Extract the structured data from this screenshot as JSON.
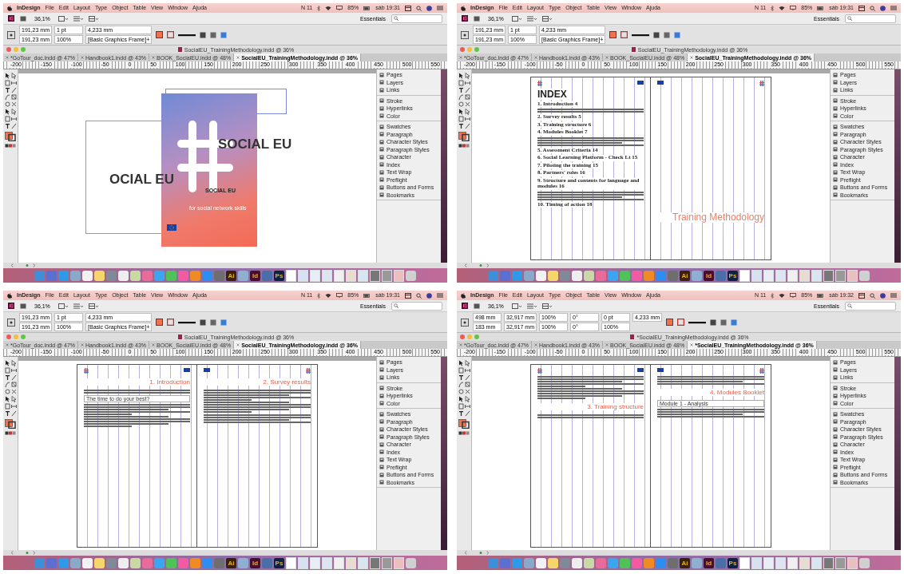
{
  "screens": [
    {
      "menubar": {
        "app": "InDesign",
        "menus": [
          "File",
          "Edit",
          "Layout",
          "Type",
          "Object",
          "Table",
          "View",
          "Window",
          "Ajuda"
        ],
        "status": [
          "N 11",
          "85%",
          "sáb 19:31"
        ]
      },
      "appbar": {
        "zoom": "36,1%",
        "workspace": "Essentials"
      },
      "control_fields": [
        "191,23 mm",
        "191,23 mm",
        "1 pt",
        "100%",
        "4,233 mm",
        "[Basic Graphics Frame]+"
      ],
      "document_title": "SocialEU_TrainingMethodology.indd @ 36%",
      "tabs": [
        {
          "label": "*GoTour_doc.indd @ 47%",
          "selected": false
        },
        {
          "label": "Handbook1.indd @ 43%",
          "selected": false
        },
        {
          "label": "BOOK_SocialEU.indd @ 48%",
          "selected": false
        },
        {
          "label": "SocialEU_TrainingMethodology.indd @ 36%",
          "selected": true
        }
      ],
      "ruler": [
        "-200",
        "-150",
        "-100",
        "-50",
        "0",
        "50",
        "100",
        "150",
        "200",
        "250",
        "300",
        "350",
        "400",
        "450",
        "500",
        "550"
      ],
      "panels": [
        [
          "Pages",
          "Layers",
          "Links"
        ],
        [
          "Stroke",
          "Hyperlinks",
          "Color"
        ],
        [
          "Swatches",
          "Paragraph",
          "Character Styles",
          "Paragraph Styles",
          "Character",
          "Index",
          "Text Wrap",
          "Preflight",
          "Buttons and Forms",
          "Bookmarks"
        ]
      ],
      "document": {
        "kind": "cover",
        "texts": [
          {
            "kind": "big",
            "text": "SOCIAL EU"
          },
          {
            "kind": "cut",
            "text": "OCIAL EU"
          },
          {
            "kind": "logo",
            "text": "SOCIAL EU"
          },
          {
            "kind": "tagline",
            "text": "for social network skills"
          }
        ]
      },
      "dock": [
        {
          "kind": "tile",
          "color": "#3f8fd8"
        },
        {
          "kind": "tile",
          "color": "#5b6fd1"
        },
        {
          "kind": "tile",
          "color": "#2f9be8"
        },
        {
          "kind": "tile",
          "color": "#8aa8c8"
        },
        {
          "kind": "tile",
          "color": "#f2f2f2"
        },
        {
          "kind": "tile",
          "color": "#f5d66a"
        },
        {
          "kind": "tile",
          "color": "#7f8a99"
        },
        {
          "kind": "tile",
          "color": "#eeeeee"
        },
        {
          "kind": "tile",
          "color": "#c9d9a3"
        },
        {
          "kind": "tile",
          "color": "#e86b9a"
        },
        {
          "kind": "tile",
          "color": "#3aa6f0"
        },
        {
          "kind": "tile",
          "color": "#4fc35a"
        },
        {
          "kind": "tile",
          "color": "#f45aa3"
        },
        {
          "kind": "tile",
          "color": "#f08a24"
        },
        {
          "kind": "tile",
          "color": "#2c8ef0"
        },
        {
          "kind": "tile",
          "color": "#6e6e6e"
        },
        {
          "kind": "app",
          "text": "Ai",
          "color": "#3b2106"
        },
        {
          "kind": "tile",
          "color": "#8fb0d0"
        },
        {
          "kind": "app",
          "text": "Id",
          "color": "#4a0d2c"
        },
        {
          "kind": "tile",
          "color": "#4a6fa8"
        },
        {
          "kind": "app",
          "text": "Ps",
          "color": "#0d2140"
        },
        {
          "kind": "doc",
          "color": "#ffffff"
        },
        {
          "kind": "doc",
          "color": "#d6e2f0"
        },
        {
          "kind": "doc",
          "color": "#e8eef5"
        },
        {
          "kind": "doc",
          "color": "#dce6f2"
        },
        {
          "kind": "doc",
          "color": "#f0f0f0"
        },
        {
          "kind": "doc",
          "color": "#e6ddd0"
        },
        {
          "kind": "doc",
          "color": "#d8e6f4"
        },
        {
          "kind": "doc",
          "color": "#777777"
        },
        {
          "kind": "doc",
          "color": "#999999"
        },
        {
          "kind": "doc",
          "color": "#e8c0c0"
        },
        {
          "kind": "tile",
          "color": "#d0d0d0"
        }
      ]
    },
    {
      "menubar": {
        "app": "InDesign",
        "menus": [
          "File",
          "Edit",
          "Layout",
          "Type",
          "Object",
          "Table",
          "View",
          "Window",
          "Ajuda"
        ],
        "status": [
          "N 11",
          "85%",
          "sáb 19:31"
        ]
      },
      "appbar": {
        "zoom": "36,1%",
        "workspace": "Essentials"
      },
      "control_fields": [
        "191,23 mm",
        "191,23 mm",
        "1 pt",
        "100%",
        "4,233 mm",
        "[Basic Graphics Frame]+"
      ],
      "document_title": "SocialEU_TrainingMethodology.indd @ 36%",
      "tabs": [
        {
          "label": "*GoTour_doc.indd @ 47%",
          "selected": false
        },
        {
          "label": "Handbook1.indd @ 43%",
          "selected": false
        },
        {
          "label": "BOOK_SocialEU.indd @ 48%",
          "selected": false
        },
        {
          "label": "SocialEU_TrainingMethodology.indd @ 36%",
          "selected": true
        }
      ],
      "ruler": [
        "-200",
        "-150",
        "-100",
        "-50",
        "0",
        "50",
        "100",
        "150",
        "200",
        "250",
        "300",
        "350",
        "400",
        "450",
        "500",
        "550"
      ],
      "panels": [
        [
          "Pages",
          "Layers",
          "Links"
        ],
        [
          "Stroke",
          "Hyperlinks",
          "Color"
        ],
        [
          "Swatches",
          "Paragraph",
          "Character Styles",
          "Paragraph Styles",
          "Character",
          "Index",
          "Text Wrap",
          "Preflight",
          "Buttons and Forms",
          "Bookmarks"
        ]
      ],
      "document": {
        "kind": "spread",
        "pages": [
          {
            "blocks": [
              {
                "kind": "index_title",
                "text": "INDEX"
              },
              {
                "kind": "entry",
                "text": "1. Introduction 4"
              },
              {
                "kind": "bars_small"
              },
              {
                "kind": "entry",
                "text": "2. Survey results 5"
              },
              {
                "kind": "entry",
                "text": "3. Training structure 6"
              },
              {
                "kind": "entry",
                "text": "4. Modules Booklet 7"
              },
              {
                "kind": "bars_medium"
              },
              {
                "kind": "entry",
                "text": "5. Assessment Criteria 14"
              },
              {
                "kind": "entry",
                "text": "6. Social Learning Platform - Check Lt 15"
              },
              {
                "kind": "entry",
                "text": "7. Piloting the training 15"
              },
              {
                "kind": "entry",
                "text": "8. Partners' roles 16"
              },
              {
                "kind": "entry",
                "text": "9. Structure and contents for language and modules 16"
              },
              {
                "kind": "bars_medium"
              },
              {
                "kind": "entry",
                "text": "10. Timing of action 18"
              }
            ]
          },
          {
            "blocks": [
              {
                "kind": "title",
                "text": "Training Methodology"
              }
            ]
          }
        ]
      },
      "dock": [
        {
          "kind": "tile",
          "color": "#3f8fd8"
        },
        {
          "kind": "tile",
          "color": "#5b6fd1"
        },
        {
          "kind": "tile",
          "color": "#2f9be8"
        },
        {
          "kind": "tile",
          "color": "#8aa8c8"
        },
        {
          "kind": "tile",
          "color": "#f2f2f2"
        },
        {
          "kind": "tile",
          "color": "#f5d66a"
        },
        {
          "kind": "tile",
          "color": "#7f8a99"
        },
        {
          "kind": "tile",
          "color": "#eeeeee"
        },
        {
          "kind": "tile",
          "color": "#c9d9a3"
        },
        {
          "kind": "tile",
          "color": "#e86b9a"
        },
        {
          "kind": "tile",
          "color": "#3aa6f0"
        },
        {
          "kind": "tile",
          "color": "#4fc35a"
        },
        {
          "kind": "tile",
          "color": "#f45aa3"
        },
        {
          "kind": "tile",
          "color": "#f08a24"
        },
        {
          "kind": "tile",
          "color": "#2c8ef0"
        },
        {
          "kind": "tile",
          "color": "#6e6e6e"
        },
        {
          "kind": "app",
          "text": "Ai",
          "color": "#3b2106"
        },
        {
          "kind": "tile",
          "color": "#8fb0d0"
        },
        {
          "kind": "app",
          "text": "Id",
          "color": "#4a0d2c"
        },
        {
          "kind": "tile",
          "color": "#4a6fa8"
        },
        {
          "kind": "app",
          "text": "Ps",
          "color": "#0d2140"
        },
        {
          "kind": "doc",
          "color": "#ffffff"
        },
        {
          "kind": "doc",
          "color": "#d6e2f0"
        },
        {
          "kind": "doc",
          "color": "#e8eef5"
        },
        {
          "kind": "doc",
          "color": "#dce6f2"
        },
        {
          "kind": "doc",
          "color": "#f0f0f0"
        },
        {
          "kind": "doc",
          "color": "#e6ddd0"
        },
        {
          "kind": "doc",
          "color": "#d8e6f4"
        },
        {
          "kind": "doc",
          "color": "#777777"
        },
        {
          "kind": "doc",
          "color": "#999999"
        },
        {
          "kind": "doc",
          "color": "#e8c0c0"
        },
        {
          "kind": "tile",
          "color": "#d0d0d0"
        }
      ]
    },
    {
      "menubar": {
        "app": "InDesign",
        "menus": [
          "File",
          "Edit",
          "Layout",
          "Type",
          "Object",
          "Table",
          "View",
          "Window",
          "Ajuda"
        ],
        "status": [
          "N 11",
          "85%",
          "sáb 19:31"
        ]
      },
      "appbar": {
        "zoom": "36,1%",
        "workspace": "Essentials"
      },
      "control_fields": [
        "191,23 mm",
        "191,23 mm",
        "1 pt",
        "100%",
        "4,233 mm",
        "[Basic Graphics Frame]+"
      ],
      "document_title": "SocialEU_TrainingMethodology.indd @ 36%",
      "tabs": [
        {
          "label": "*GoTour_doc.indd @ 47%",
          "selected": false
        },
        {
          "label": "Handbook1.indd @ 43%",
          "selected": false
        },
        {
          "label": "BOOK_SocialEU.indd @ 48%",
          "selected": false
        },
        {
          "label": "SocialEU_TrainingMethodology.indd @ 36%",
          "selected": true
        }
      ],
      "ruler": [
        "-200",
        "-150",
        "-100",
        "-50",
        "0",
        "50",
        "100",
        "150",
        "200",
        "250",
        "300",
        "350",
        "400",
        "450",
        "500",
        "550"
      ],
      "panels": [
        [
          "Pages",
          "Layers",
          "Links"
        ],
        [
          "Stroke",
          "Hyperlinks",
          "Color"
        ],
        [
          "Swatches",
          "Paragraph",
          "Character Styles",
          "Paragraph Styles",
          "Character",
          "Index",
          "Text Wrap",
          "Preflight",
          "Buttons and Forms",
          "Bookmarks"
        ]
      ],
      "document": {
        "kind": "spread",
        "pages": [
          {
            "blocks": [
              {
                "kind": "heading",
                "text": "1. Introduction"
              },
              {
                "kind": "bars_small"
              },
              {
                "kind": "note",
                "text": "The time to do your best?"
              },
              {
                "kind": "bars_large"
              }
            ]
          },
          {
            "blocks": [
              {
                "kind": "heading",
                "text": "2. Survey results"
              },
              {
                "kind": "bars_large"
              },
              {
                "kind": "bars_medium"
              }
            ]
          }
        ]
      },
      "dock": [
        {
          "kind": "tile",
          "color": "#3f8fd8"
        },
        {
          "kind": "tile",
          "color": "#5b6fd1"
        },
        {
          "kind": "tile",
          "color": "#2f9be8"
        },
        {
          "kind": "tile",
          "color": "#8aa8c8"
        },
        {
          "kind": "tile",
          "color": "#f2f2f2"
        },
        {
          "kind": "tile",
          "color": "#f5d66a"
        },
        {
          "kind": "tile",
          "color": "#7f8a99"
        },
        {
          "kind": "tile",
          "color": "#eeeeee"
        },
        {
          "kind": "tile",
          "color": "#c9d9a3"
        },
        {
          "kind": "tile",
          "color": "#e86b9a"
        },
        {
          "kind": "tile",
          "color": "#3aa6f0"
        },
        {
          "kind": "tile",
          "color": "#4fc35a"
        },
        {
          "kind": "tile",
          "color": "#f45aa3"
        },
        {
          "kind": "tile",
          "color": "#f08a24"
        },
        {
          "kind": "tile",
          "color": "#2c8ef0"
        },
        {
          "kind": "tile",
          "color": "#6e6e6e"
        },
        {
          "kind": "app",
          "text": "Ai",
          "color": "#3b2106"
        },
        {
          "kind": "tile",
          "color": "#8fb0d0"
        },
        {
          "kind": "app",
          "text": "Id",
          "color": "#4a0d2c"
        },
        {
          "kind": "tile",
          "color": "#4a6fa8"
        },
        {
          "kind": "app",
          "text": "Ps",
          "color": "#0d2140"
        },
        {
          "kind": "doc",
          "color": "#ffffff"
        },
        {
          "kind": "doc",
          "color": "#d6e2f0"
        },
        {
          "kind": "doc",
          "color": "#e8eef5"
        },
        {
          "kind": "doc",
          "color": "#dce6f2"
        },
        {
          "kind": "doc",
          "color": "#f0f0f0"
        },
        {
          "kind": "doc",
          "color": "#e6ddd0"
        },
        {
          "kind": "doc",
          "color": "#d8e6f4"
        },
        {
          "kind": "doc",
          "color": "#777777"
        },
        {
          "kind": "doc",
          "color": "#999999"
        },
        {
          "kind": "doc",
          "color": "#e8c0c0"
        },
        {
          "kind": "tile",
          "color": "#d0d0d0"
        }
      ]
    },
    {
      "menubar": {
        "app": "InDesign",
        "menus": [
          "File",
          "Edit",
          "Layout",
          "Type",
          "Object",
          "Table",
          "View",
          "Window",
          "Ajuda"
        ],
        "status": [
          "N 11",
          "85%",
          "sáb 19:32"
        ]
      },
      "appbar": {
        "zoom": "36,1%",
        "workspace": "Essentials"
      },
      "control_fields": [
        "498 mm",
        "183 mm",
        "32,917 mm",
        "32,917 mm",
        "100%",
        "100%",
        "0°",
        "0°",
        "0 pt",
        "100%",
        "4,233 mm"
      ],
      "document_title": "*SocialEU_TrainingMethodology.indd @ 36%",
      "tabs": [
        {
          "label": "*GoTour_doc.indd @ 47%",
          "selected": false
        },
        {
          "label": "Handbook1.indd @ 43%",
          "selected": false
        },
        {
          "label": "BOOK_SocialEU.indd @ 48%",
          "selected": false
        },
        {
          "label": "*SocialEU_TrainingMethodology.indd @ 36%",
          "selected": true
        }
      ],
      "ruler": [
        "-200",
        "-150",
        "-100",
        "-50",
        "0",
        "50",
        "100",
        "150",
        "200",
        "250",
        "300",
        "350",
        "400",
        "450",
        "500",
        "550"
      ],
      "panels": [
        [
          "Pages",
          "Layers",
          "Links"
        ],
        [
          "Stroke",
          "Hyperlinks",
          "Color"
        ],
        [
          "Swatches",
          "Paragraph",
          "Character Styles",
          "Paragraph Styles",
          "Character",
          "Index",
          "Text Wrap",
          "Preflight",
          "Buttons and Forms",
          "Bookmarks"
        ]
      ],
      "document": {
        "kind": "spread",
        "pages": [
          {
            "blocks": [
              {
                "kind": "bars_large"
              },
              {
                "kind": "heading",
                "text": "3. Training structure"
              },
              {
                "kind": "bars_small"
              }
            ]
          },
          {
            "blocks": [
              {
                "kind": "bars_medium"
              },
              {
                "kind": "heading",
                "text": "4. Modules Booklet"
              },
              {
                "kind": "note",
                "text": "Module 1 - Analysis"
              },
              {
                "kind": "bars_medium"
              }
            ]
          }
        ]
      },
      "dock": [
        {
          "kind": "tile",
          "color": "#3f8fd8"
        },
        {
          "kind": "tile",
          "color": "#5b6fd1"
        },
        {
          "kind": "tile",
          "color": "#2f9be8"
        },
        {
          "kind": "tile",
          "color": "#8aa8c8"
        },
        {
          "kind": "tile",
          "color": "#f2f2f2"
        },
        {
          "kind": "tile",
          "color": "#f5d66a"
        },
        {
          "kind": "tile",
          "color": "#7f8a99"
        },
        {
          "kind": "tile",
          "color": "#eeeeee"
        },
        {
          "kind": "tile",
          "color": "#c9d9a3"
        },
        {
          "kind": "tile",
          "color": "#e86b9a"
        },
        {
          "kind": "tile",
          "color": "#3aa6f0"
        },
        {
          "kind": "tile",
          "color": "#4fc35a"
        },
        {
          "kind": "tile",
          "color": "#f45aa3"
        },
        {
          "kind": "tile",
          "color": "#f08a24"
        },
        {
          "kind": "tile",
          "color": "#2c8ef0"
        },
        {
          "kind": "tile",
          "color": "#6e6e6e"
        },
        {
          "kind": "app",
          "text": "Ai",
          "color": "#3b2106"
        },
        {
          "kind": "tile",
          "color": "#8fb0d0"
        },
        {
          "kind": "app",
          "text": "Id",
          "color": "#4a0d2c"
        },
        {
          "kind": "tile",
          "color": "#4a6fa8"
        },
        {
          "kind": "app",
          "text": "Ps",
          "color": "#0d2140"
        },
        {
          "kind": "doc",
          "color": "#ffffff"
        },
        {
          "kind": "doc",
          "color": "#d6e2f0"
        },
        {
          "kind": "doc",
          "color": "#e8eef5"
        },
        {
          "kind": "doc",
          "color": "#dce6f2"
        },
        {
          "kind": "doc",
          "color": "#f0f0f0"
        },
        {
          "kind": "doc",
          "color": "#e6ddd0"
        },
        {
          "kind": "doc",
          "color": "#d8e6f4"
        },
        {
          "kind": "doc",
          "color": "#777777"
        },
        {
          "kind": "doc",
          "color": "#999999"
        },
        {
          "kind": "doc",
          "color": "#e8c0c0"
        },
        {
          "kind": "tile",
          "color": "#d0d0d0"
        }
      ]
    }
  ]
}
